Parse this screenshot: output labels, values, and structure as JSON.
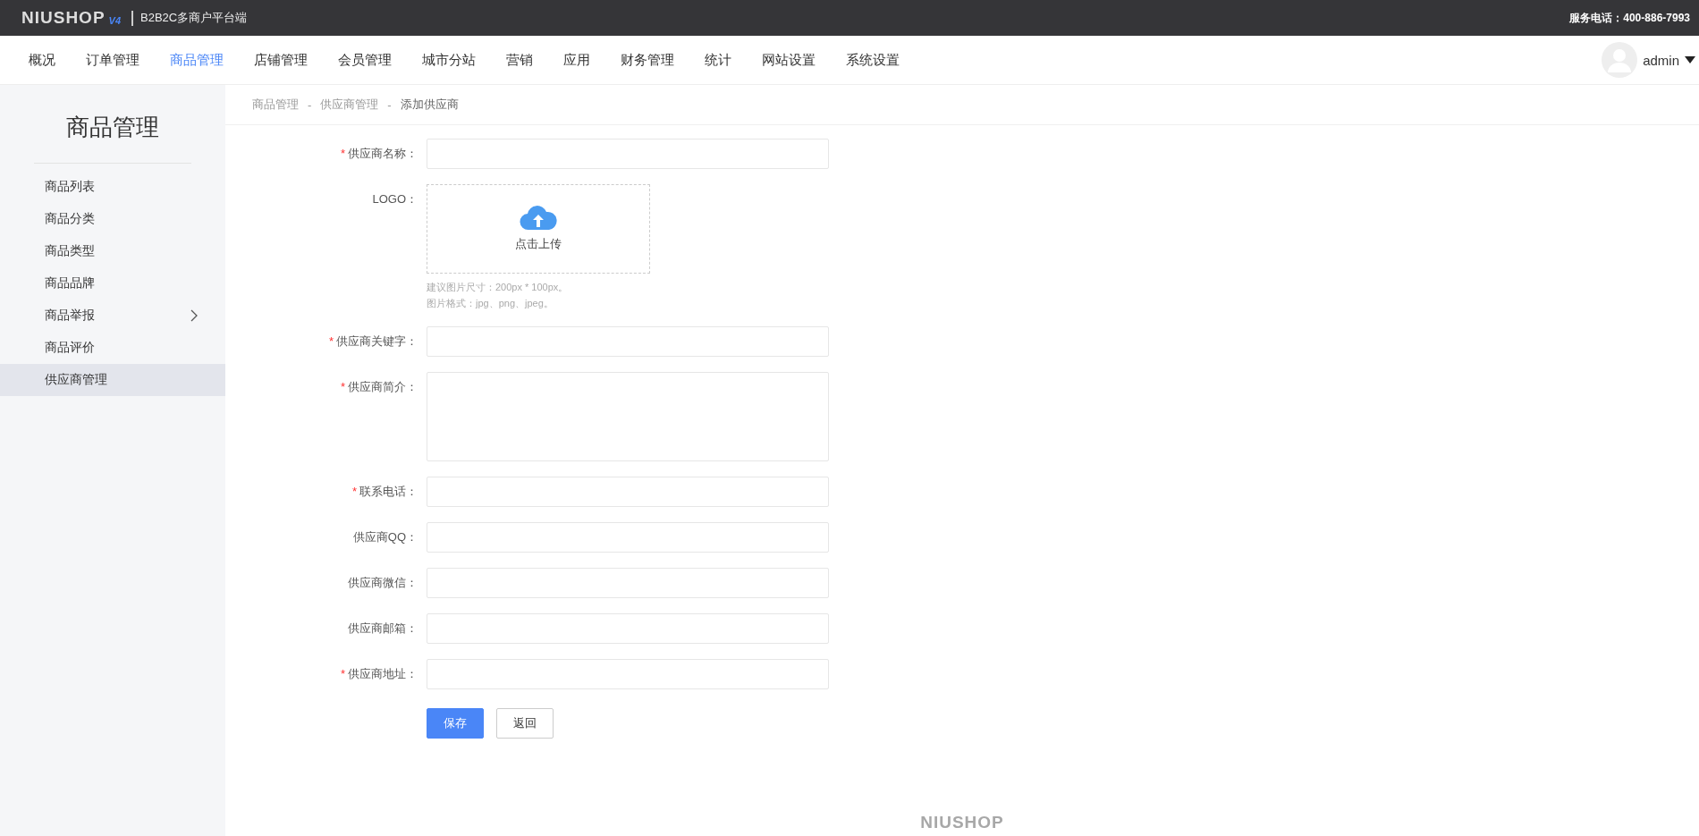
{
  "top_bar": {
    "logo": "NIUSHOP",
    "logo_version": "V4",
    "platform": "B2B2C多商户平台端",
    "hotline": "服务电话：400-886-7993"
  },
  "nav": [
    {
      "label": "概况",
      "selected": false
    },
    {
      "label": "订单管理",
      "selected": false
    },
    {
      "label": "商品管理",
      "selected": true
    },
    {
      "label": "店铺管理",
      "selected": false
    },
    {
      "label": "会员管理",
      "selected": false
    },
    {
      "label": "城市分站",
      "selected": false
    },
    {
      "label": "营销",
      "selected": false
    },
    {
      "label": "应用",
      "selected": false
    },
    {
      "label": "财务管理",
      "selected": false
    },
    {
      "label": "统计",
      "selected": false
    },
    {
      "label": "网站设置",
      "selected": false
    },
    {
      "label": "系统设置",
      "selected": false
    }
  ],
  "user": {
    "name": "admin"
  },
  "sidebar": {
    "title": "商品管理",
    "items": [
      {
        "label": "商品列表",
        "selected": false,
        "expandable": false
      },
      {
        "label": "商品分类",
        "selected": false,
        "expandable": false
      },
      {
        "label": "商品类型",
        "selected": false,
        "expandable": false
      },
      {
        "label": "商品品牌",
        "selected": false,
        "expandable": false
      },
      {
        "label": "商品举报",
        "selected": false,
        "expandable": true
      },
      {
        "label": "商品评价",
        "selected": false,
        "expandable": false
      },
      {
        "label": "供应商管理",
        "selected": true,
        "expandable": false
      }
    ]
  },
  "breadcrumb": {
    "separator": "-",
    "items": [
      "商品管理",
      "供应商管理",
      "添加供应商"
    ]
  },
  "form": {
    "required_mark": "*",
    "fields": [
      {
        "kind": "input",
        "label": "供应商名称：",
        "required": true
      },
      {
        "kind": "upload",
        "label": "LOGO：",
        "required": false,
        "upload_text": "点击上传",
        "hints": [
          "建议图片尺寸：200px * 100px。",
          "图片格式：jpg、png、jpeg。"
        ]
      },
      {
        "kind": "input",
        "label": "供应商关键字：",
        "required": true
      },
      {
        "kind": "textarea",
        "label": "供应商简介：",
        "required": true
      },
      {
        "kind": "input",
        "label": "联系电话：",
        "required": true
      },
      {
        "kind": "input",
        "label": "供应商QQ：",
        "required": false
      },
      {
        "kind": "input",
        "label": "供应商微信：",
        "required": false
      },
      {
        "kind": "input",
        "label": "供应商邮箱：",
        "required": false
      },
      {
        "kind": "input",
        "label": "供应商地址：",
        "required": true
      }
    ],
    "buttons": [
      {
        "label": "保存",
        "kind": "primary"
      },
      {
        "label": "返回",
        "kind": "default"
      }
    ]
  },
  "footer": {
    "logo": "NIUSHOP"
  }
}
